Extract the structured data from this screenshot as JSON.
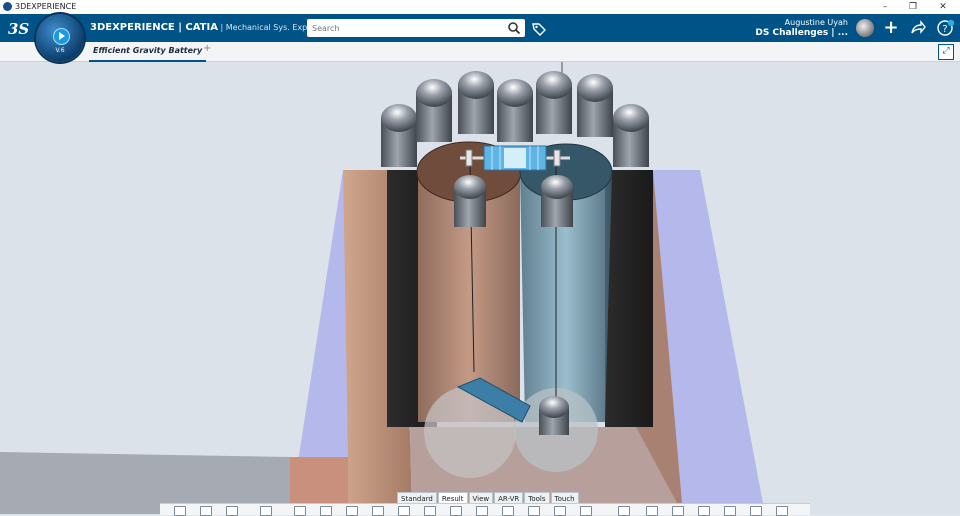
{
  "window": {
    "title": "3DEXPERIENCE",
    "controls": [
      "–",
      "❐",
      "✕"
    ]
  },
  "header": {
    "logo": "3S",
    "brand_main": "3DEXPERIENCE | CATIA",
    "brand_sub": " | Mechanical Sys. Experie...",
    "search_placeholder": "Search",
    "user_name": "Augustine Uyah",
    "user_context": "DS Challenges | ...",
    "compass_version": "V.6",
    "icons": [
      "search-icon",
      "tag-icon",
      "add-icon",
      "share-icon",
      "help-icon"
    ]
  },
  "tabs": {
    "active": "Efficient Gravity Battery",
    "add": "+"
  },
  "action_bar": {
    "tabs": [
      "Standard",
      "Result",
      "View",
      "AR-VR",
      "Tools",
      "Touch"
    ],
    "active_tab": "Result"
  },
  "colors": {
    "brand_blue": "#005386",
    "tab_bg": "#f2f4f6"
  }
}
